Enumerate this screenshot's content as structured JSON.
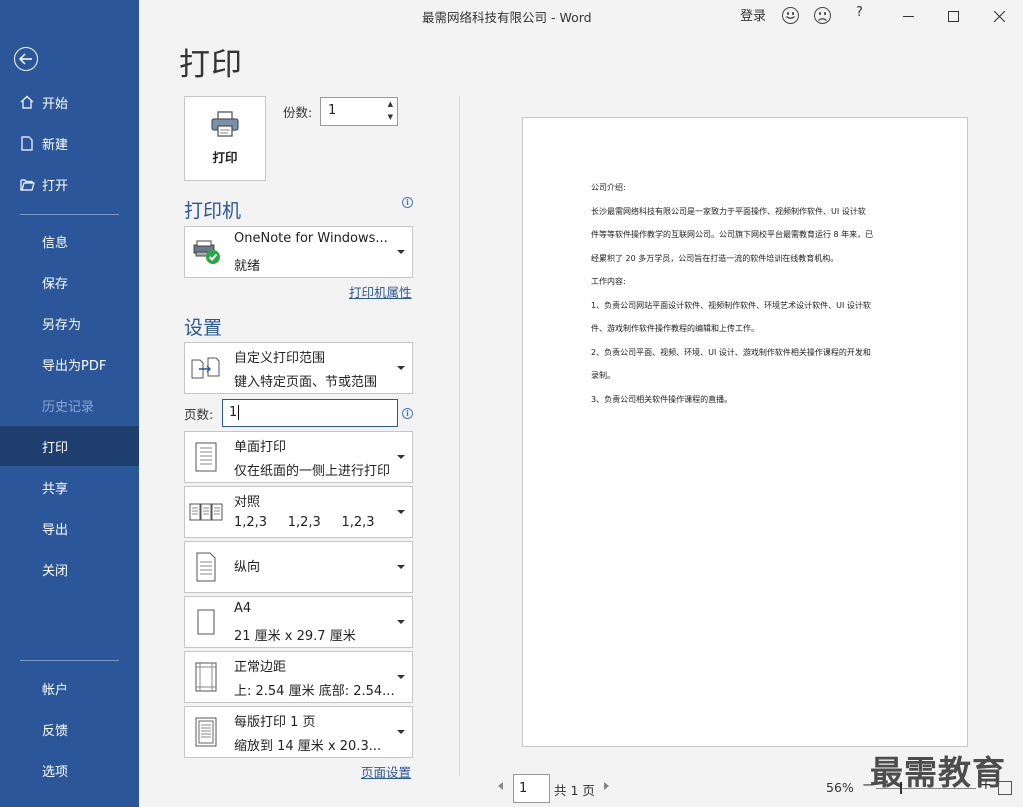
{
  "titlebar": {
    "title": "最需网络科技有限公司  -  Word",
    "login": "登录",
    "help": "?"
  },
  "sidebar": {
    "items": [
      {
        "label": "开始",
        "icon": "home-icon"
      },
      {
        "label": "新建",
        "icon": "new-doc-icon"
      },
      {
        "label": "打开",
        "icon": "folder-open-icon"
      },
      {
        "label": "信息"
      },
      {
        "label": "保存"
      },
      {
        "label": "另存为"
      },
      {
        "label": "导出为PDF"
      },
      {
        "label": "历史记录",
        "disabled": true
      },
      {
        "label": "打印",
        "active": true
      },
      {
        "label": "共享"
      },
      {
        "label": "导出"
      },
      {
        "label": "关闭"
      },
      {
        "label": "帐户"
      },
      {
        "label": "反馈"
      },
      {
        "label": "选项"
      }
    ]
  },
  "print": {
    "page_title": "打印",
    "print_button": "打印",
    "copies_label": "份数:",
    "copies_value": "1",
    "printer_heading": "打印机",
    "printer_name": "OneNote for Windows...",
    "printer_status": "就绪",
    "printer_properties": "打印机属性",
    "settings_heading": "设置",
    "range_title": "自定义打印范围",
    "range_sub": "键入特定页面、节或范围",
    "pages_label": "页数:",
    "pages_value": "1",
    "sides_title": "单面打印",
    "sides_sub": "仅在纸面的一侧上进行打印",
    "collate_title": "对照",
    "collate_sub": "1,2,3     1,2,3     1,2,3",
    "orientation_title": "纵向",
    "paper_title": "A4",
    "paper_sub": "21 厘米 x 29.7 厘米",
    "margins_title": "正常边距",
    "margins_sub": "上: 2.54 厘米 底部: 2.54...",
    "persheet_title": "每版打印 1 页",
    "persheet_sub": "缩放到 14 厘米 x 20.3...",
    "page_setup": "页面设置"
  },
  "preview": {
    "lines": [
      "公司介绍:",
      "长沙最需网络科技有限公司是一家致力于平面操作、视频制作软件、UI 设计软",
      "件等等软件操作教学的互联网公司。公司旗下网校平台最需教育运行 8 年来，已",
      "经累积了 20 多万学员，公司旨在打造一流的软件培训在线教育机构。",
      "工作内容:",
      "1、负责公司网站平面设计软件、视频制作软件、环境艺术设计软件、UI 设计软",
      "件、游戏制作软件操作教程的编辑和上传工作。",
      "2、负责公司平面、视频、环境、UI 设计、游戏制作软件相关操作课程的开发和",
      "录制。",
      "3、负责公司相关软件操作课程的直播。"
    ]
  },
  "statusbar": {
    "page_current": "1",
    "page_total": "共 1 页",
    "zoom": "56%",
    "zoom_minus": "−",
    "zoom_plus": "+"
  },
  "watermark": "最需教育"
}
